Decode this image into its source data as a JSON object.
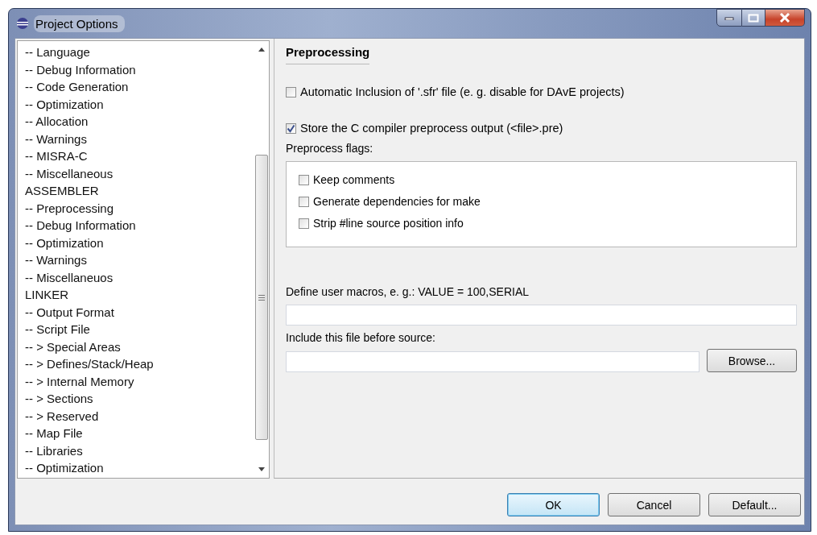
{
  "window": {
    "title": "Project Options"
  },
  "tree": {
    "items": [
      "-- Language",
      "-- Debug Information",
      "-- Code Generation",
      "-- Optimization",
      "-- Allocation",
      "-- Warnings",
      "-- MISRA-C",
      "-- Miscellaneous",
      "ASSEMBLER",
      "-- Preprocessing",
      "-- Debug Information",
      "-- Optimization",
      "-- Warnings",
      "-- Miscellaneuos",
      "LINKER",
      "-- Output Format",
      "-- Script File",
      "-- > Special Areas",
      "-- > Defines/Stack/Heap",
      "-- > Internal Memory",
      "-- > Sections",
      "-- > Reserved",
      "-- Map File",
      "-- Libraries",
      "-- Optimization"
    ]
  },
  "page": {
    "heading": "Preprocessing",
    "options": [
      {
        "label": "Automatic Inclusion of '.sfr' file (e. g. disable for DAvE projects)",
        "checked": false
      },
      {
        "label": "Store the C compiler preprocess output (<file>.pre)",
        "checked": true
      }
    ],
    "flags_label": "Preprocess flags:",
    "flags": [
      {
        "label": "Keep comments",
        "checked": false
      },
      {
        "label": "Generate dependencies for make",
        "checked": false
      },
      {
        "label": "Strip #line source position info",
        "checked": false
      }
    ],
    "macros_label": "Define user macros, e. g.: VALUE = 100,SERIAL",
    "include_label": "Include this file before source:",
    "browse_button": "Browse..."
  },
  "buttons": [
    "OK",
    "Cancel",
    "Default..."
  ]
}
